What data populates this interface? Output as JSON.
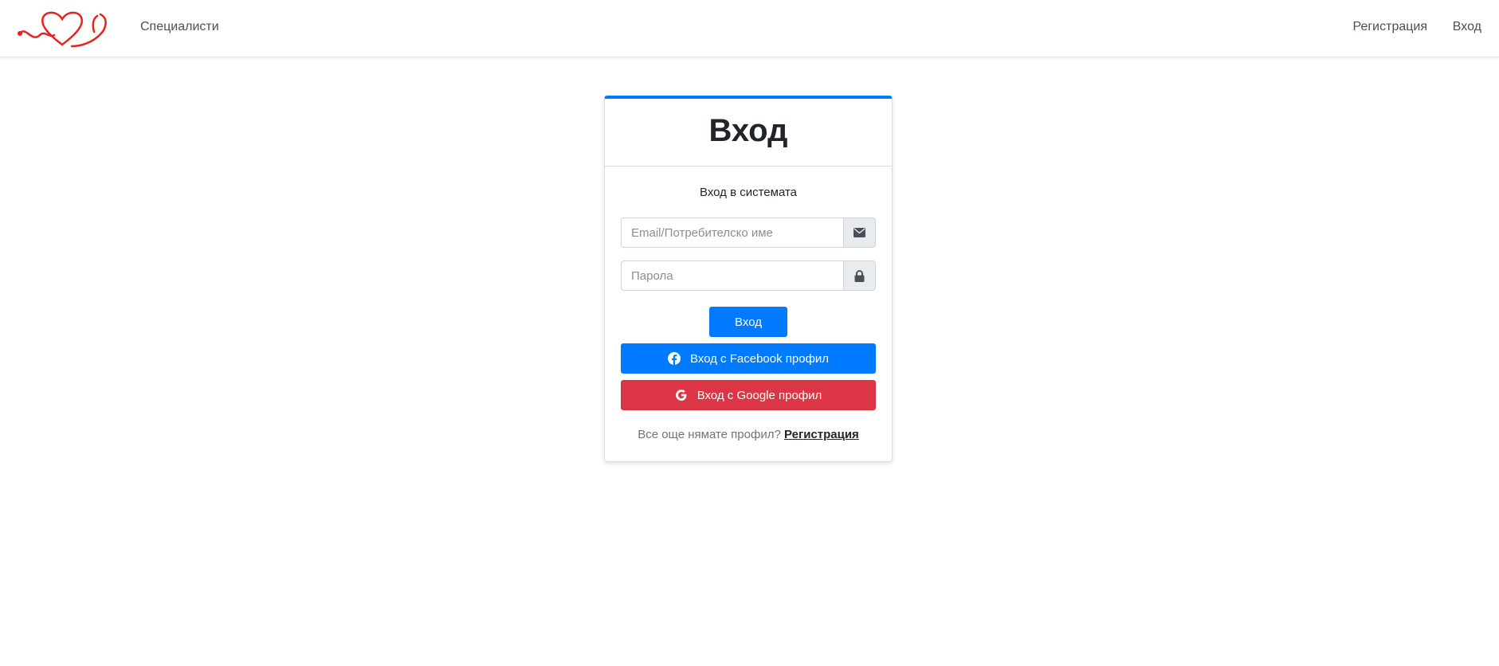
{
  "navbar": {
    "logo_icon": "heart-stethoscope-logo",
    "links": {
      "specialists": "Специалисти",
      "register": "Регистрация",
      "login": "Вход"
    }
  },
  "login_card": {
    "title": "Вход",
    "subtitle": "Вход в системата",
    "email_placeholder": "Email/Потребителско име",
    "email_icon": "envelope-icon",
    "password_placeholder": "Парола",
    "password_icon": "lock-icon",
    "submit_label": "Вход",
    "facebook_label": "Вход с Facebook профил",
    "google_label": "Вход с Google профил",
    "no_account_text": "Все още нямате профил?",
    "register_link": "Регистрация"
  },
  "colors": {
    "primary": "#007bff",
    "danger": "#dc3545",
    "logo": "#e8221b"
  }
}
